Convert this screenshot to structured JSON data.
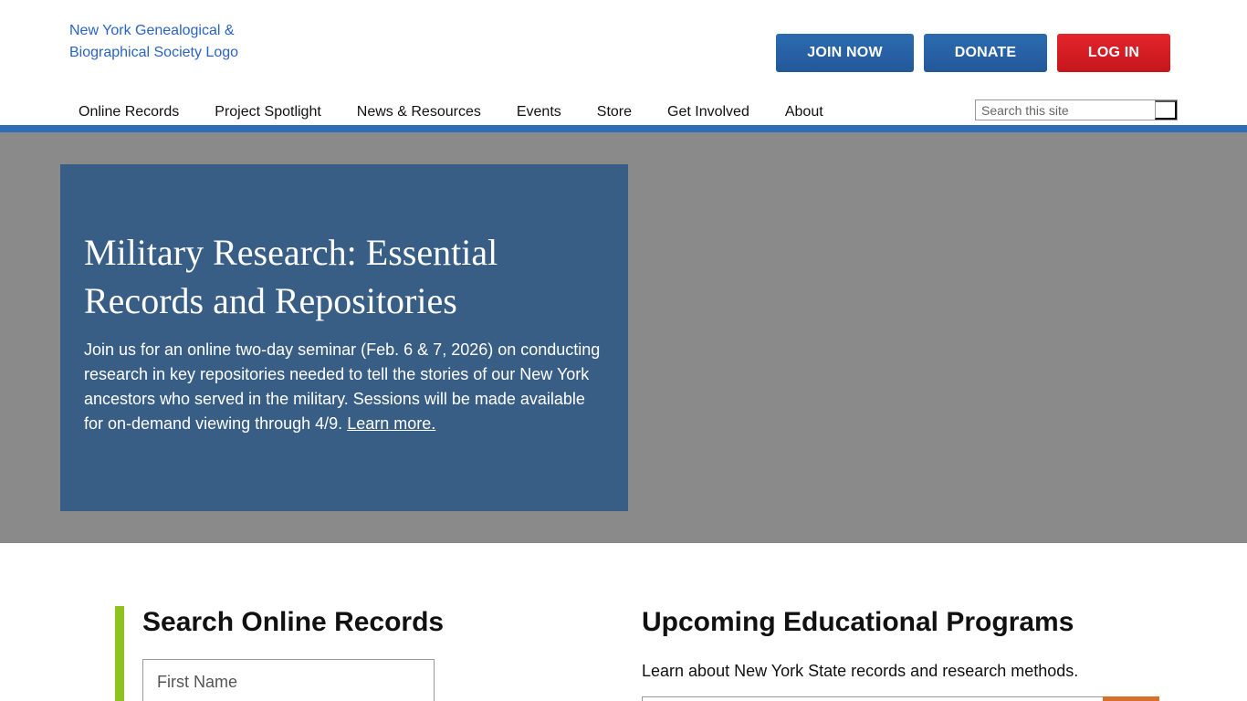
{
  "header": {
    "logo_alt": "New York Genealogical & Biographical Society Logo",
    "buttons": {
      "join": "JOIN NOW",
      "donate": "DONATE",
      "login": "LOG IN"
    },
    "nav": [
      "Online Records",
      "Project Spotlight",
      "News & Resources",
      "Events",
      "Store",
      "Get Involved",
      "About"
    ],
    "search_placeholder": "Search this site"
  },
  "hero": {
    "title": "Military Research: Essential Records and Repositories",
    "text": "Join us for an online two-day seminar (Feb. 6 & 7, 2026) on conducting research in key repositories needed to tell the stories of our New York ancestors who served in the military. Sessions will be made available for on-demand viewing through 4/9.",
    "link": "Learn more."
  },
  "search_records": {
    "heading": "Search Online Records",
    "first_name_placeholder": "First Name"
  },
  "programs": {
    "heading": "Upcoming Educational Programs",
    "description": "Learn about New York State records and research methods."
  },
  "colors": {
    "brand_blue": "#2e6db4",
    "hero_card": "#385e86",
    "login_red": "#c4161c",
    "accent_green": "#8dc21f",
    "accent_orange": "#d5702d"
  }
}
